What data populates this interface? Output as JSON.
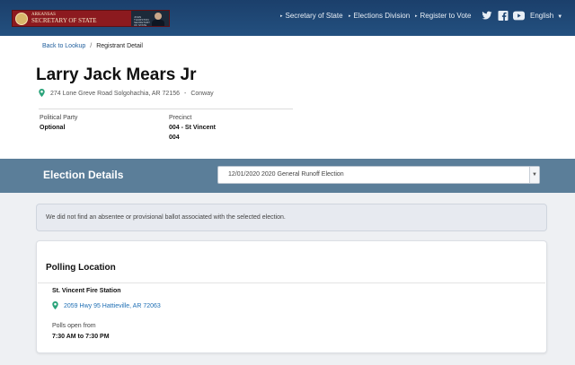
{
  "header": {
    "logo": {
      "line1": "ARKANSAS",
      "line2": "SECRETARY OF STATE",
      "portrait_caption": "JOHN THURSTON SECRETARY OF STATE"
    },
    "nav": [
      {
        "label": "Secretary of State",
        "icon": "caret-right-icon"
      },
      {
        "label": "Elections Division",
        "icon": "caret-right-icon"
      },
      {
        "label": "Register to Vote",
        "icon": "caret-right-icon"
      }
    ],
    "social": [
      "twitter-icon",
      "facebook-icon",
      "youtube-icon"
    ],
    "language": "English"
  },
  "breadcrumb": {
    "back_label": "Back to Lookup",
    "separator": "/",
    "current": "Registrant Detail"
  },
  "registrant": {
    "name": "Larry Jack Mears Jr",
    "address": "274 Lone Greve Road Solgohachia, AR 72156",
    "dash": "-",
    "county": "Conway",
    "party_label": "Political Party",
    "party_value": "Optional",
    "precinct_label": "Precinct",
    "precinct_value": "004 - St Vincent",
    "precinct_code": "004"
  },
  "election": {
    "title": "Election Details",
    "selected": "12/01/2020 2020 General Runoff Election"
  },
  "notice": "We did not find an absentee or provisional ballot associated with the selected election.",
  "polling": {
    "title": "Polling Location",
    "station": "St. Vincent Fire Station",
    "address": "2059 Hwy 95 Hattieville, AR 72063",
    "hours_label": "Polls open from",
    "hours_value": "7:30 AM to 7:30 PM"
  },
  "colors": {
    "header": "#1b3f6b",
    "band": "#5b7e99",
    "link": "#1f5e9c",
    "pin": "#2aa37a"
  }
}
